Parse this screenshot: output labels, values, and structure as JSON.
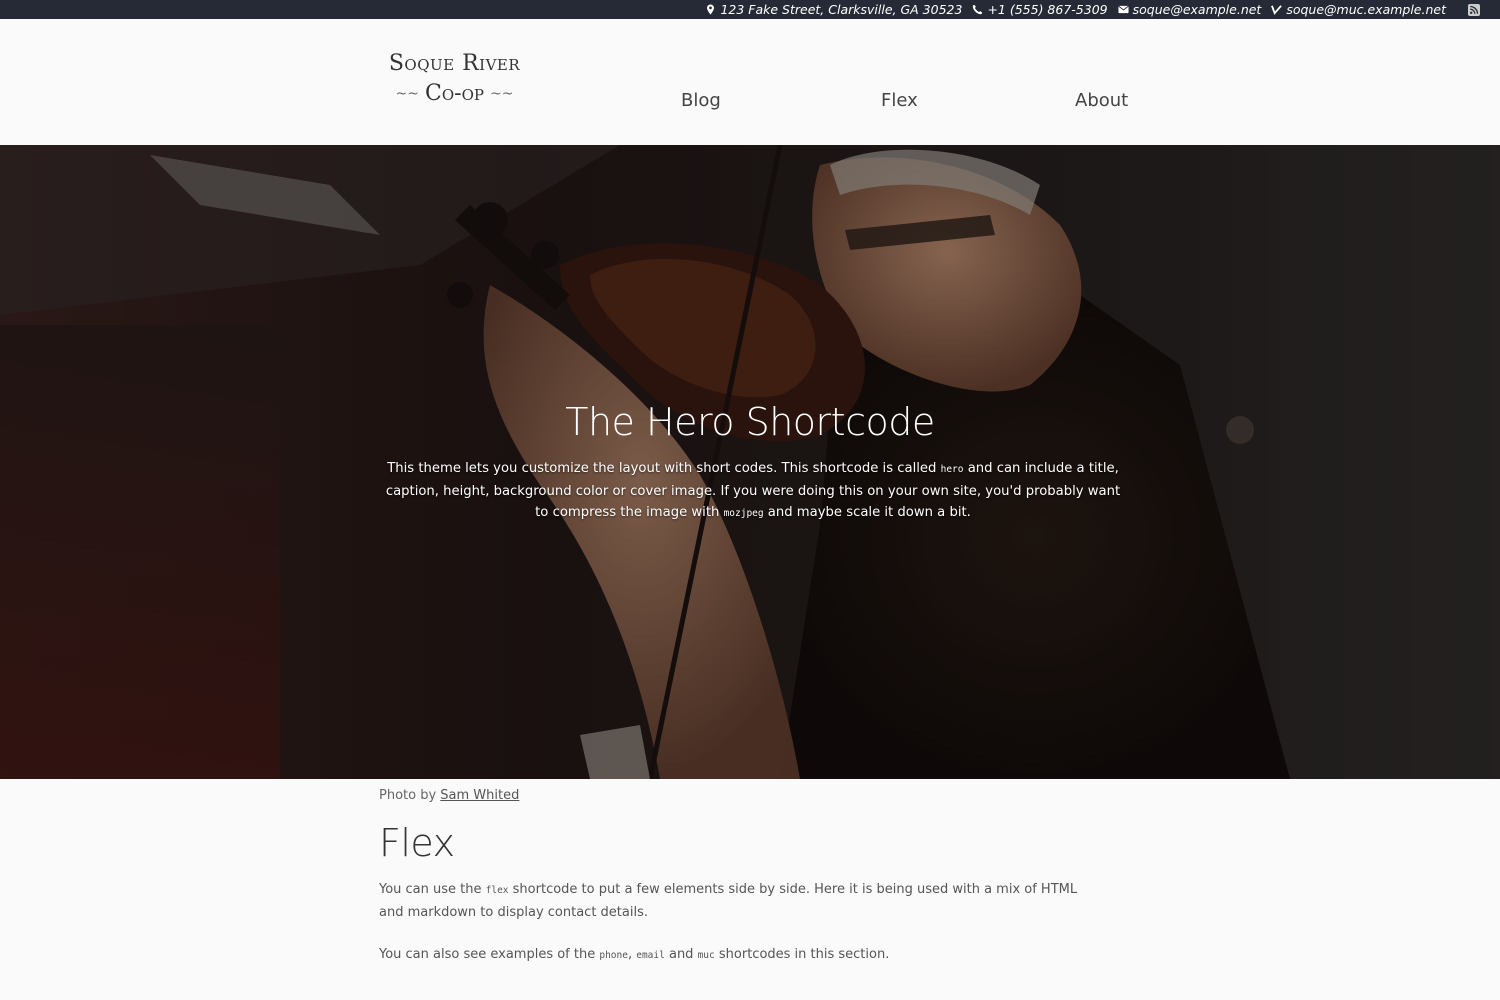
{
  "topbar": {
    "address": "123 Fake Street, Clarksville, GA 30523",
    "phone": "+1 (555) 867-5309",
    "email": "soque@example.net",
    "muc": "soque@muc.example.net",
    "icons": [
      "map-marker-icon",
      "phone-icon",
      "envelope-icon",
      "vine-icon",
      "rss-icon"
    ]
  },
  "logo": {
    "line1": "Soque River",
    "line2": "Co-op",
    "tilde": "~~"
  },
  "nav": {
    "items": [
      "Blog",
      "Flex",
      "About"
    ]
  },
  "hero": {
    "title": "The Hero Shortcode",
    "text_1": "This theme lets you customize the layout with short codes. This shortcode is called ",
    "code_1": "hero",
    "text_2": " and can include a title, caption, height, background color or cover image. If you were doing this on your own site, you'd probably want to compress the image with ",
    "code_2": "mozjpeg",
    "text_3": " and maybe scale it down a bit."
  },
  "credit": {
    "prefix": "Photo by ",
    "author": "Sam Whited"
  },
  "flex": {
    "heading": "Flex",
    "p1_a": "You can use the ",
    "p1_code": "flex",
    "p1_b": " shortcode to put a few elements side by side. Here it is being used with a mix of HTML and markdown to display contact details.",
    "p2_a": "You can also see examples of the ",
    "p2_code1": "phone",
    "p2_sep1": ", ",
    "p2_code2": "email",
    "p2_sep2": " and ",
    "p2_code3": "muc",
    "p2_b": " shortcodes in this section."
  },
  "colors": {
    "topbar_bg": "#262a36",
    "page_bg": "#fafafa"
  }
}
